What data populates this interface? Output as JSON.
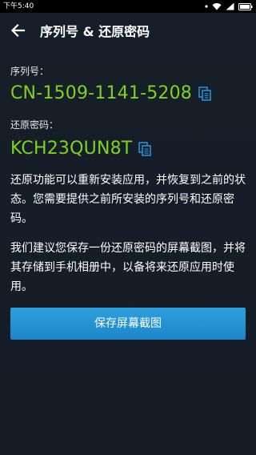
{
  "status_bar": {
    "time": "下午5:40",
    "icons": [
      "dot-icon",
      "wifi-icon",
      "signal-icon",
      "battery-icon"
    ]
  },
  "header": {
    "title": "序列号 & 还原密码",
    "back_icon": "arrow-left-icon"
  },
  "serial": {
    "label": "序列号：",
    "value": "CN-1509-1141-5208",
    "copy_icon": "copy-icon"
  },
  "restore_code": {
    "label": "还原密码：",
    "value": "KCH23QUN8T",
    "copy_icon": "copy-icon"
  },
  "paragraphs": [
    "还原功能可以重新安装应用，并恢复到之前的状态。您需要提供之前所安装的序列号和还原密码。",
    "我们建议您保存一份还原密码的屏幕截图，并将其存储到手机相册中，以备将来还原应用时使用。"
  ],
  "save_button": {
    "label": "保存屏幕截图"
  },
  "colors": {
    "background": "#141c26",
    "accent_green": "#7ed321",
    "copy_icon_blue": "#2a8fd6",
    "button_blue": "#2196d6",
    "text": "#ffffff"
  }
}
